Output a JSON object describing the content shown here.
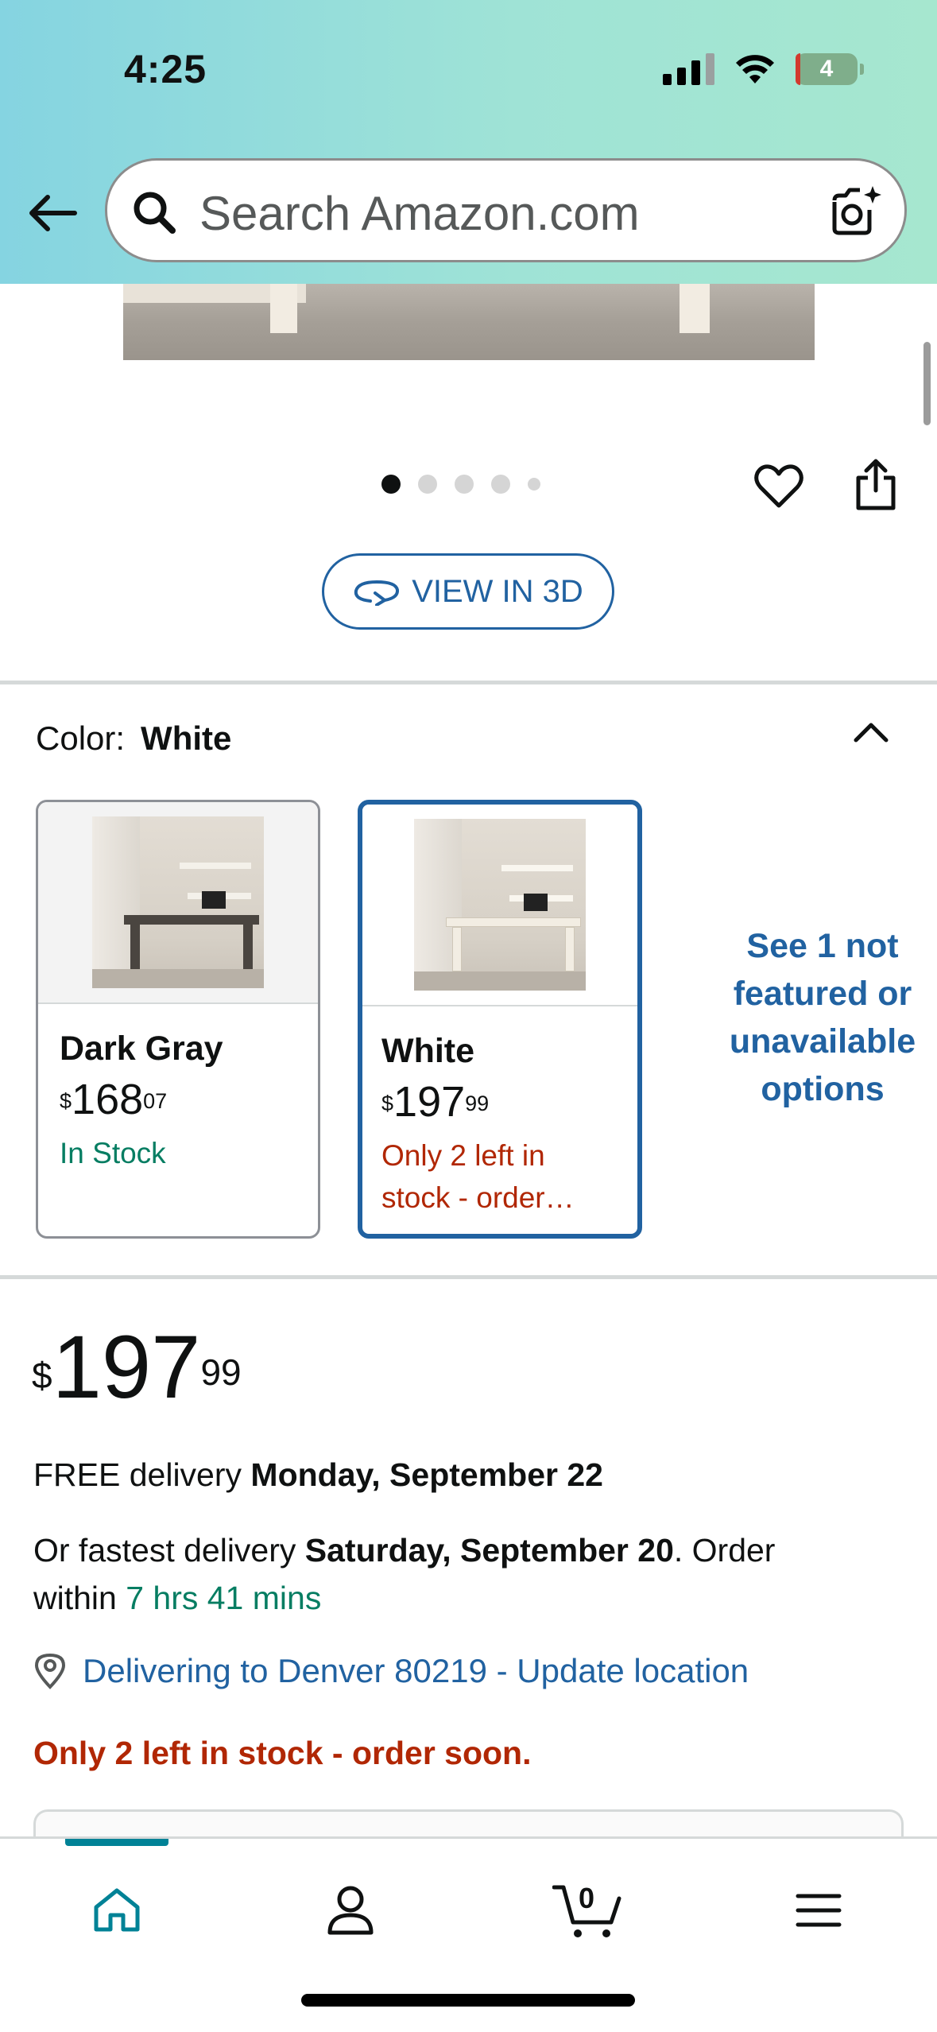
{
  "status_bar": {
    "time": "4:25",
    "battery": "4"
  },
  "search": {
    "placeholder": "Search Amazon.com"
  },
  "gallery": {
    "dots_count": 5,
    "active_index": 0
  },
  "view3d_label": "VIEW IN 3D",
  "color": {
    "label": "Color:",
    "selected": "White",
    "options": [
      {
        "name": "Dark Gray",
        "currency": "$",
        "price_whole": "168",
        "price_fraction": "07",
        "availability": "In Stock"
      },
      {
        "name": "White",
        "currency": "$",
        "price_whole": "197",
        "price_fraction": "99",
        "availability": "Only 2 left in stock - order…"
      }
    ],
    "more_options": "See 1 not featured or unavailable options"
  },
  "price": {
    "currency": "$",
    "whole": "197",
    "fraction": "99"
  },
  "delivery": {
    "free_prefix": "FREE delivery ",
    "free_date": "Monday, September 22",
    "fast_prefix": "Or fastest delivery ",
    "fast_date": "Saturday, September 20",
    "fast_suffix": ". Order",
    "within_prefix": "within ",
    "countdown": "7 hrs 41 mins",
    "location": "Delivering to Denver 80219 - Update location"
  },
  "stock_warning": "Only 2 left in stock - order soon.",
  "bottom_nav": {
    "cart_count": "0"
  },
  "colors": {
    "link": "#2162a1",
    "teal": "#067d62",
    "red": "#b12704"
  }
}
